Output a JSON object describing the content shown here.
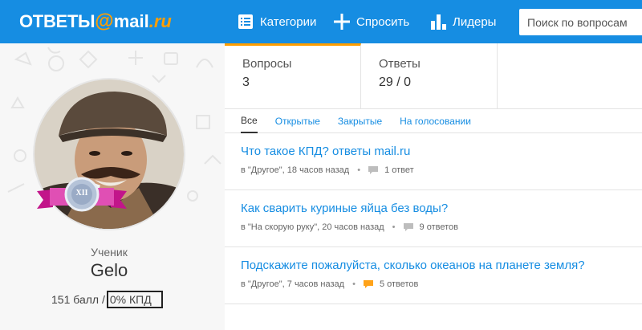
{
  "header": {
    "logo_text": "ОТВЕТЫ",
    "logo_at": "@",
    "logo_domain": "mail",
    "logo_ru": ".ru",
    "nav": [
      {
        "label": "Категории",
        "icon": "list-icon"
      },
      {
        "label": "Спросить",
        "icon": "plus-icon"
      },
      {
        "label": "Лидеры",
        "icon": "bar-chart-icon"
      }
    ],
    "search_placeholder": "Поиск по вопросам"
  },
  "profile": {
    "rank_badge": "XII",
    "role": "Ученик",
    "name": "Gelo",
    "points": "151 балл /",
    "kpd": "0% КПД"
  },
  "counters": {
    "questions_label": "Вопросы",
    "questions_value": "3",
    "answers_label": "Ответы",
    "answers_value": "29 / 0"
  },
  "tabs": [
    "Все",
    "Открытые",
    "Закрытые",
    "На голосовании"
  ],
  "questions": [
    {
      "title": "Что такое КПД? ответы mail.ru",
      "meta": "в \"Другое\", 18 часов назад",
      "answers": "1 ответ",
      "bubble_color": "#bdbdbd"
    },
    {
      "title": "Как сварить куриные яйца без воды?",
      "meta": "в \"На скорую руку\", 20 часов назад",
      "answers": "9 ответов",
      "bubble_color": "#bdbdbd"
    },
    {
      "title": "Подскажите пожалуйста, сколько океанов на планете земля?",
      "meta": "в \"Другое\", 7 часов назад",
      "answers": "5 ответов",
      "bubble_color": "#ffa31a"
    }
  ],
  "colors": {
    "brand": "#168de2",
    "accent": "#ff9e00"
  }
}
